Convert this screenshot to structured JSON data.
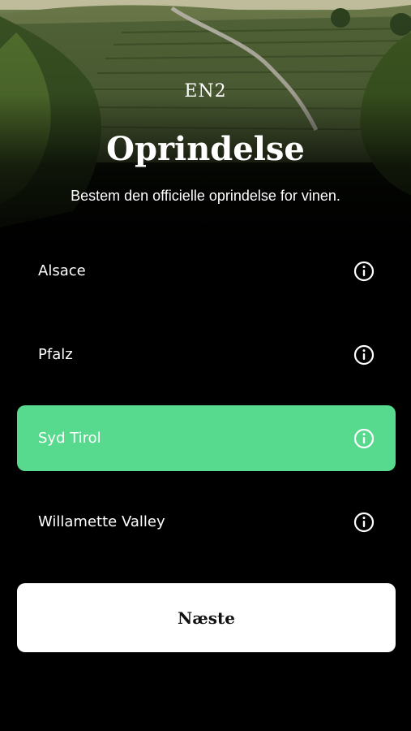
{
  "header": {
    "logo": "EN2",
    "title": "Oprindelse",
    "subtitle": "Bestem den officielle oprindelse for vinen."
  },
  "options": [
    {
      "label": "Alsace",
      "selected": false,
      "icon": "info-icon"
    },
    {
      "label": "Pfalz",
      "selected": false,
      "icon": "info-icon"
    },
    {
      "label": "Syd Tirol",
      "selected": true,
      "icon": "info-icon"
    },
    {
      "label": "Willamette Valley",
      "selected": false,
      "icon": "info-icon"
    }
  ],
  "next_button": {
    "label": "Næste"
  },
  "colors": {
    "background": "#000000",
    "selected": "#57d98e",
    "button": "#ffffff"
  }
}
